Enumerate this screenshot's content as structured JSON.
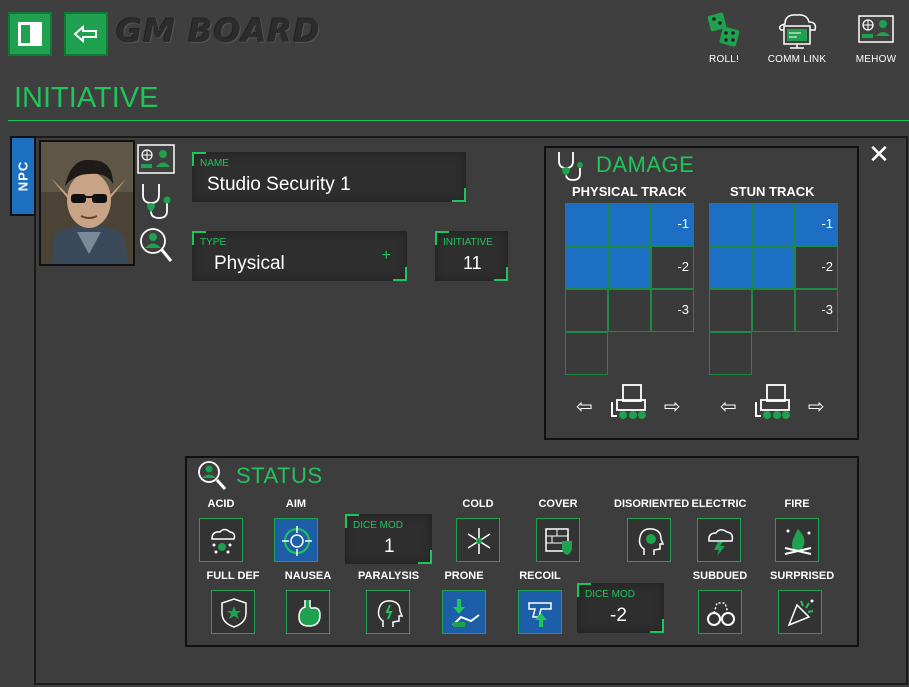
{
  "app": {
    "logo": "GM BOARD",
    "actions": [
      {
        "label": "ROLL!",
        "icon": "dice-icon"
      },
      {
        "label": "COMM LINK",
        "icon": "comm-link-icon"
      },
      {
        "label": "MEHOW",
        "icon": "id-card-icon"
      }
    ]
  },
  "page": {
    "title": "INITIATIVE"
  },
  "character": {
    "tag": "NPC",
    "name_label": "NAME",
    "name": "Studio Security 1",
    "type_label": "TYPE",
    "type": "Physical",
    "type_plus": "+",
    "initiative_label": "INITIATIVE",
    "initiative": "11"
  },
  "damage": {
    "title": "DAMAGE",
    "physical": {
      "label": "PHYSICAL TRACK",
      "filled": 5,
      "modifiers": [
        "-1",
        "-2",
        "-3"
      ]
    },
    "stun": {
      "label": "STUN TRACK",
      "filled": 5,
      "modifiers": [
        "-1",
        "-2",
        "-3"
      ]
    }
  },
  "status": {
    "title": "STATUS",
    "row1": [
      {
        "label": "ACID",
        "active": false,
        "icon": "acid-cloud-icon"
      },
      {
        "label": "AIM",
        "active": true,
        "icon": "crosshair-icon"
      },
      {
        "label": "COLD",
        "active": false,
        "icon": "snowflake-icon"
      },
      {
        "label": "COVER",
        "active": false,
        "icon": "shield-wall-icon"
      },
      {
        "label": "DISORIENTED",
        "active": false,
        "icon": "confused-head-icon"
      },
      {
        "label": "ELECTRIC",
        "active": false,
        "icon": "lightning-cloud-icon"
      },
      {
        "label": "FIRE",
        "active": false,
        "icon": "fire-icon"
      }
    ],
    "row2": [
      {
        "label": "FULL DEF",
        "active": false,
        "icon": "star-shield-icon"
      },
      {
        "label": "NAUSEA",
        "active": false,
        "icon": "stomach-icon"
      },
      {
        "label": "PARALYSIS",
        "active": false,
        "icon": "paralysis-head-icon"
      },
      {
        "label": "PRONE",
        "active": true,
        "icon": "prone-icon"
      },
      {
        "label": "RECOIL",
        "active": true,
        "icon": "recoil-gun-icon"
      },
      {
        "label": "SUBDUED",
        "active": false,
        "icon": "handcuffs-icon"
      },
      {
        "label": "SURPRISED",
        "active": false,
        "icon": "surprise-icon"
      }
    ],
    "aim_dice_mod_label": "DICE MOD",
    "aim_dice_mod": "1",
    "recoil_dice_mod_label": "DICE MOD",
    "recoil_dice_mod": "-2"
  },
  "colors": {
    "accent": "#1fc45a",
    "button": "#1fa14f",
    "filled": "#1c6fc2",
    "npc_tab": "#1d6fc0"
  }
}
